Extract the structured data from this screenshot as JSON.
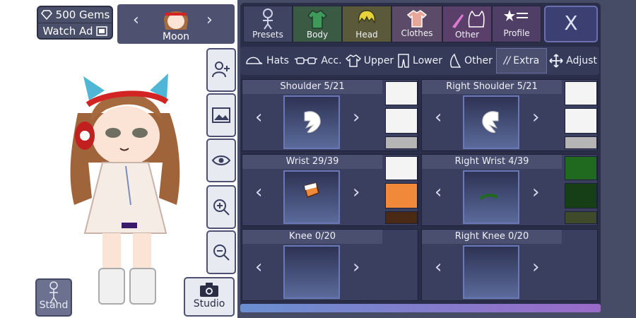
{
  "currency": {
    "gems_label": "500 Gems",
    "watch_ad_label": "Watch Ad"
  },
  "character": {
    "name": "Moon"
  },
  "side_tools": [
    "add-character",
    "background",
    "visibility",
    "zoom-in",
    "zoom-out"
  ],
  "bottom_buttons": {
    "stand_label": "Stand",
    "studio_label": "Studio"
  },
  "top_tabs": [
    {
      "label": "Presets",
      "icon": "figure-icon"
    },
    {
      "label": "Body",
      "icon": "jacket-icon"
    },
    {
      "label": "Head",
      "icon": "hair-icon"
    },
    {
      "label": "Clothes",
      "icon": "shirt-icon",
      "active": true
    },
    {
      "label": "Other",
      "icon": "sword-cat-icon"
    },
    {
      "label": "Profile",
      "icon": "star-list-icon"
    }
  ],
  "close_label": "X",
  "sub_tabs": [
    {
      "label": "Hats",
      "icon": "cap-icon"
    },
    {
      "label": "Acc.",
      "icon": "glasses-icon"
    },
    {
      "label": "Upper",
      "icon": "shirt-icon"
    },
    {
      "label": "Lower",
      "icon": "pants-icon"
    },
    {
      "label": "Other",
      "icon": "sail-icon"
    },
    {
      "label": "Extra",
      "icon": "slashes-icon",
      "active": true
    },
    {
      "label": "Adjust",
      "icon": "move-icon"
    }
  ],
  "slots": [
    {
      "title": "Shoulder 5/21",
      "colors": [
        "#f4f4f4",
        "#f4f4f4",
        "#b5b5b5"
      ]
    },
    {
      "title": "Right Shoulder 5/21",
      "colors": [
        "#f4f4f4",
        "#f4f4f4",
        "#b5b5b5"
      ]
    },
    {
      "title": "Wrist 29/39",
      "colors": [
        "#f4f4f4",
        "#f08a3a",
        "#4a2a14"
      ]
    },
    {
      "title": "Right Wrist 4/39",
      "colors": [
        "#1f6a1f",
        "#173f17",
        "#3f4a2a"
      ]
    },
    {
      "title": "Knee 0/20",
      "colors": []
    },
    {
      "title": "Right Knee 0/20",
      "colors": []
    }
  ],
  "colors": {
    "panel": "#474c66",
    "tab": "#3f4463",
    "active_tab": "#5b4b68",
    "slot": "#3a3f60"
  }
}
